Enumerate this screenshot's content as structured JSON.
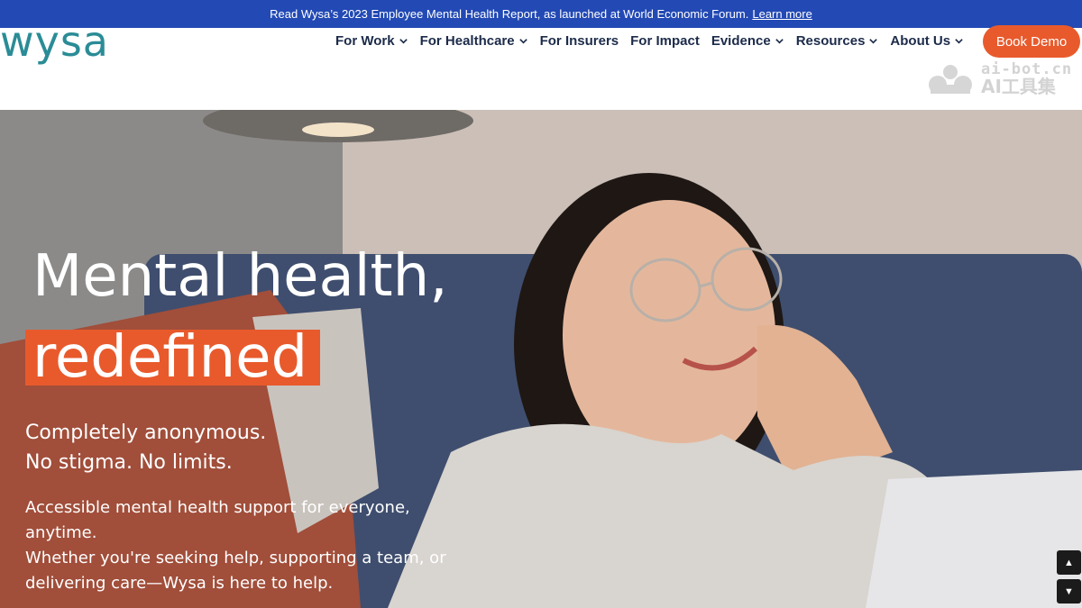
{
  "announcement": {
    "text": "Read Wysa’s 2023 Employee Mental Health Report, as launched at World Economic Forum.",
    "link": "Learn more"
  },
  "header": {
    "logo": "wysa",
    "nav": [
      {
        "label": "For Work",
        "dropdown": true
      },
      {
        "label": "For Healthcare",
        "dropdown": true
      },
      {
        "label": "For Insurers",
        "dropdown": false
      },
      {
        "label": "For Impact",
        "dropdown": false
      },
      {
        "label": "Evidence",
        "dropdown": true
      },
      {
        "label": "Resources",
        "dropdown": true
      },
      {
        "label": "About Us",
        "dropdown": true
      }
    ],
    "cta": "Book Demo"
  },
  "watermark": {
    "line1": "ai-bot.cn",
    "line2": "AI工具集"
  },
  "hero": {
    "headline": "Mental health,",
    "highlight": "redefined",
    "subheading_line1": "Completely anonymous.",
    "subheading_line2": "No stigma. No limits.",
    "body_line1": "Accessible mental health support for everyone, anytime.",
    "body_line2": "Whether you're seeking help, supporting a team, or",
    "body_line3": "delivering care—Wysa is here to help."
  },
  "colors": {
    "announcement_bg": "#2249b4",
    "brand_teal": "#2a8c96",
    "accent_orange": "#e85a2c",
    "nav_text": "#1c2b4a"
  },
  "icons": {
    "nav_dropdown": "chevron-down-icon",
    "scroll_up": "arrow-up-icon",
    "scroll_down": "arrow-down-icon",
    "watermark": "bot-logo-icon"
  }
}
